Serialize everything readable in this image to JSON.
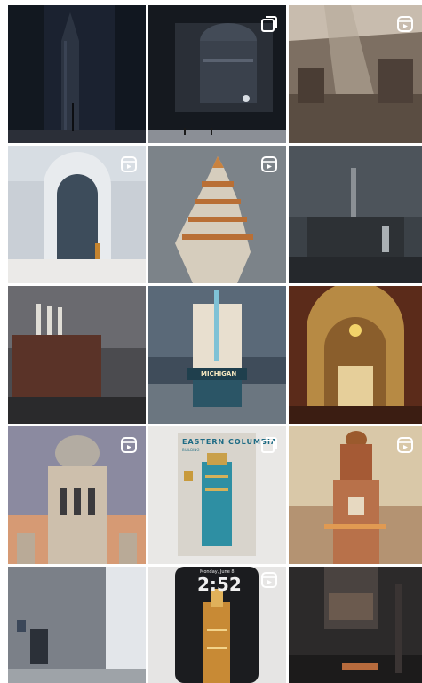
{
  "grid": {
    "columns": 3,
    "rows": 5,
    "tiles": [
      {
        "id": "t1",
        "subject": "dark city street with tall tower",
        "badge": ""
      },
      {
        "id": "t2",
        "subject": "domed building at night plaza",
        "badge": "carousel-icon"
      },
      {
        "id": "t3",
        "subject": "industrial interior with light rays",
        "badge": "reel-icon"
      },
      {
        "id": "t4",
        "subject": "white arched art deco doorway",
        "badge": "reel-icon"
      },
      {
        "id": "t5",
        "subject": "aerial view of stepped skyscraper",
        "badge": "reel-icon"
      },
      {
        "id": "t6",
        "subject": "industrial plant under stormy sky",
        "badge": ""
      },
      {
        "id": "t7",
        "subject": "brick power station with smokestacks",
        "badge": ""
      },
      {
        "id": "t8",
        "subject": "Michigan theater facade",
        "badge": ""
      },
      {
        "id": "t9",
        "subject": "ornate arched interior with clock",
        "badge": ""
      },
      {
        "id": "t10",
        "subject": "domed baroque building",
        "badge": "reel-icon"
      },
      {
        "id": "t11",
        "subject": "Eastern Columbia poster",
        "badge": "carousel-icon"
      },
      {
        "id": "t12",
        "subject": "ornate tower at sunset",
        "badge": "reel-icon"
      },
      {
        "id": "t13",
        "subject": "city street with buildings",
        "badge": ""
      },
      {
        "id": "t14",
        "subject": "phone lock screen with art deco tower",
        "badge": "reel-icon"
      },
      {
        "id": "t15",
        "subject": "dark industrial street scene",
        "badge": ""
      }
    ]
  },
  "tile8": {
    "sign_text": "MICHIGAN"
  },
  "tile11": {
    "poster_title": "EASTERN COLUMBIA",
    "poster_sub": "BUILDING"
  },
  "tile14": {
    "lock_date": "Monday, June 8",
    "lock_time": "2:52"
  },
  "colors": {
    "background": "#ffffff",
    "poster_accent": "#1e6c85"
  }
}
